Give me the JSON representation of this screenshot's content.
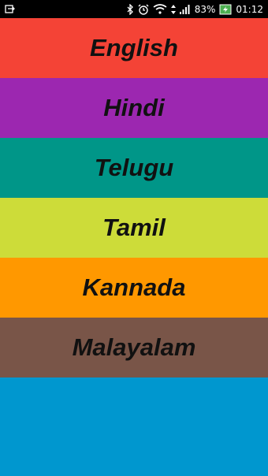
{
  "status_bar": {
    "battery": "83%",
    "time": "01:12",
    "icons": [
      "usb-icon",
      "bluetooth-icon",
      "alarm-icon",
      "wifi-icon",
      "signal-icon",
      "battery-charging-icon"
    ]
  },
  "languages": [
    {
      "label": "English",
      "color": "#F44336"
    },
    {
      "label": "Hindi",
      "color": "#9C27B0"
    },
    {
      "label": "Telugu",
      "color": "#009688"
    },
    {
      "label": "Tamil",
      "color": "#CDDC39"
    },
    {
      "label": "Kannada",
      "color": "#FF9800"
    },
    {
      "label": "Malayalam",
      "color": "#795548"
    }
  ],
  "bottom_color": "#0097CF"
}
